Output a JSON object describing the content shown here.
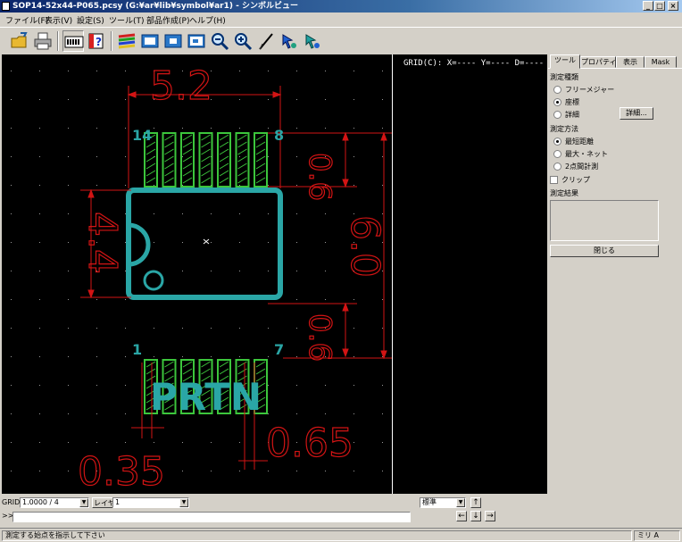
{
  "window": {
    "title": "SOP14-52x44-P065.pcsy (G:¥ar¥lib¥symbol¥ar1) - シンボルビュー",
    "minimize": "_",
    "maximize": "□",
    "close": "×"
  },
  "menu": [
    "ファイル(F)",
    "表示(V)",
    "設定(S)",
    "ツール(T)",
    "部品作成(P)",
    "ヘルプ(H)"
  ],
  "toolbar": {
    "buttons": [
      {
        "name": "open-folder-icon"
      },
      {
        "name": "print-icon"
      },
      {
        "name": "pin-grid-icon"
      },
      {
        "name": "help-icon"
      },
      {
        "name": "layers-icon"
      },
      {
        "name": "zoom-fit-icon"
      },
      {
        "name": "zoom-window-icon"
      },
      {
        "name": "zoom-area-icon"
      },
      {
        "name": "zoom-out-icon"
      },
      {
        "name": "zoom-in-icon"
      },
      {
        "name": "measure-icon"
      },
      {
        "name": "pan-icon"
      },
      {
        "name": "redraw-icon"
      }
    ]
  },
  "footprint": {
    "dim_top": "5.2",
    "dim_left": "4.4",
    "dim_right_top": "0.6",
    "dim_right_overall": "6.0",
    "dim_right_bottom": "0.6",
    "dim_pad_width": "0.35",
    "dim_pitch": "0.65",
    "pin1_top_label": "14",
    "pin8_label": "8",
    "pin1_label": "1",
    "pin7_label": "7",
    "ref_label": "PRTN"
  },
  "info_canvas": {
    "grid_readout": "GRID(C):  X=----  Y=----  D=----"
  },
  "panel": {
    "tabs": [
      "ツール",
      "プロパティ",
      "表示",
      "Mask"
    ],
    "active_tab": 0,
    "group1_label": "測定種類",
    "group1_options": [
      "フリーメジャー",
      "座標",
      "詳細"
    ],
    "group1_selected": 1,
    "detail_button": "詳細...",
    "group2_label": "測定方法",
    "group2_options": [
      "最短距離",
      "最大・ネット",
      "2点間計測"
    ],
    "group2_selected": 0,
    "clip_label": "クリップ",
    "result_label": "測定結果",
    "close_button": "閉じる"
  },
  "bottom": {
    "grid_label": "GRID",
    "grid_value": "1.0000 / 4",
    "layer_label": "レイヤ",
    "layer_value": "1",
    "prompt": ">>",
    "scale_value": "標準"
  },
  "status": {
    "message": "測定する始点を指示して下さい",
    "mode": "ミリ A"
  },
  "colors": {
    "pad_green": "#3cc63c",
    "dim_red": "#d21414",
    "outline_teal": "#2aa6a6"
  }
}
